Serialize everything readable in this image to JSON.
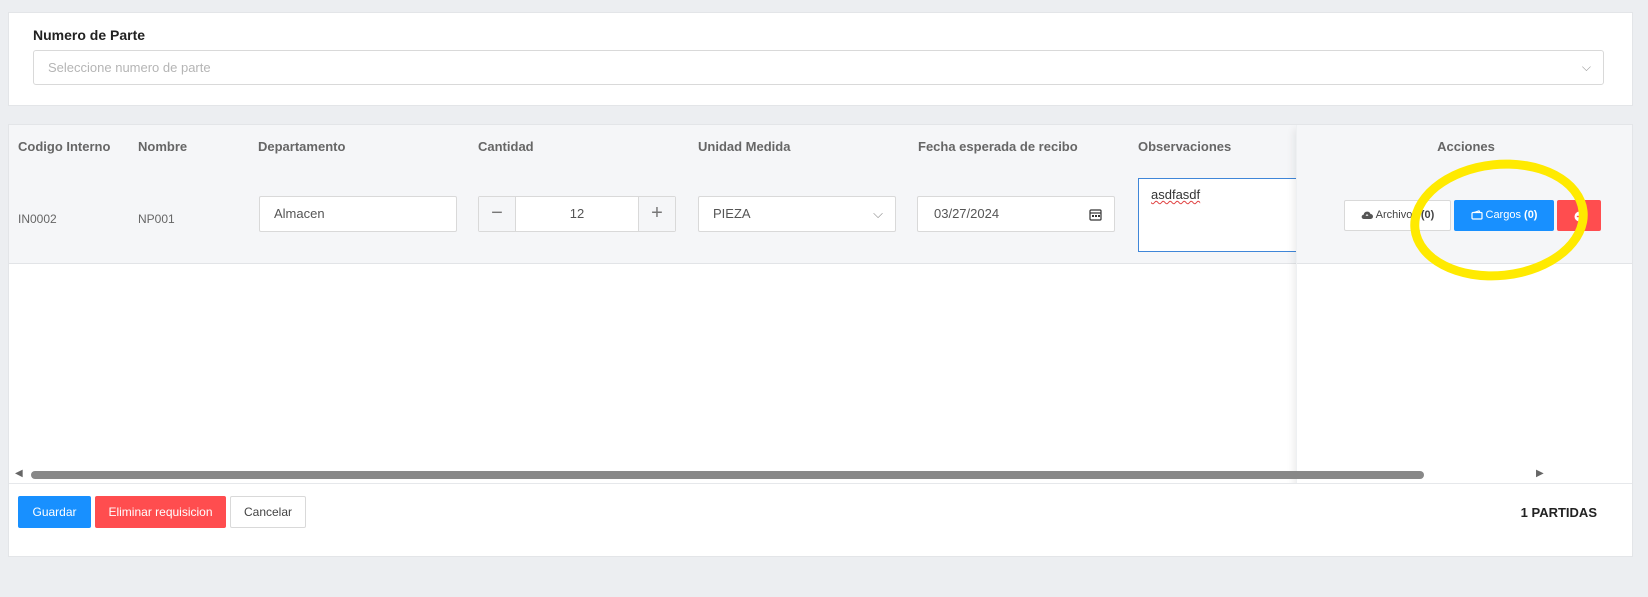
{
  "part": {
    "label": "Numero de Parte",
    "placeholder": "Seleccione numero de parte"
  },
  "table": {
    "headers": [
      "Codigo Interno",
      "Nombre",
      "Departamento",
      "Cantidad",
      "Unidad Medida",
      "Fecha esperada de recibo",
      "Observaciones",
      "Acciones"
    ],
    "row": {
      "codigo": "IN0002",
      "nombre": "NP001",
      "departamento": "Almacen",
      "cantidad": "12",
      "unidad": "PIEZA",
      "fecha": "03/27/2024",
      "observaciones": "asdfasdf"
    },
    "actions": {
      "files_label": "Archivos",
      "files_count": "(0)",
      "cargos_label": "Cargos",
      "cargos_count": "(0)"
    }
  },
  "footer": {
    "save": "Guardar",
    "delete": "Eliminar requisicion",
    "cancel": "Cancelar",
    "count": "1 PARTIDAS"
  },
  "icons": {
    "files": "cloud-upload-icon",
    "cargos": "wallet-icon",
    "remove": "minus-circle-icon",
    "calendar": "calendar-icon"
  },
  "colors": {
    "primary": "#1890ff",
    "danger": "#ff4d4f",
    "highlight": "#ffea00"
  }
}
